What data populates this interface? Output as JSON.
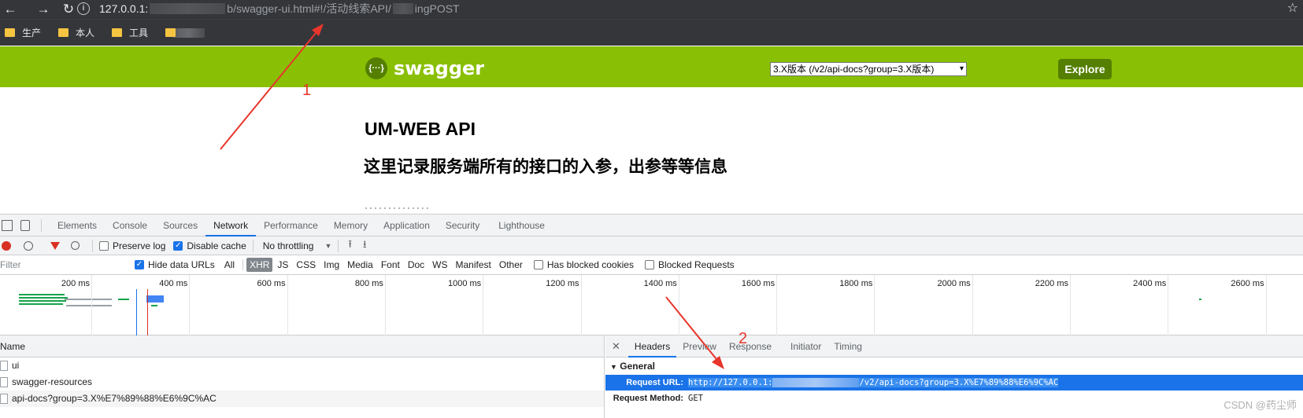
{
  "browser": {
    "url_host": "127.0.0.1:",
    "url_path": "b/swagger-ui.html#!/活动线索API/",
    "url_tail": "ingPOST",
    "bookmarks": [
      {
        "label": "生产"
      },
      {
        "label": "本人"
      },
      {
        "label": "工具"
      }
    ]
  },
  "swagger": {
    "logo_glyph": "{···}",
    "logo_text": "swagger",
    "group_select_value": "3.X版本 (/v2/api-docs?group=3.X版本)",
    "explore_label": "Explore",
    "api_title": "UM-WEB API",
    "api_description": "这里记录服务端所有的接口的入参，出参等等信息"
  },
  "devtools": {
    "tabs": [
      "Elements",
      "Console",
      "Sources",
      "Network",
      "Performance",
      "Memory",
      "Application",
      "Security",
      "Lighthouse"
    ],
    "active_tab": "Network",
    "toolbar": {
      "preserve_log": "Preserve log",
      "disable_cache": "Disable cache",
      "throttling": "No throttling"
    },
    "filter": {
      "placeholder": "Filter",
      "hide_data_urls": "Hide data URLs",
      "types": [
        "All",
        "XHR",
        "JS",
        "CSS",
        "Img",
        "Media",
        "Font",
        "Doc",
        "WS",
        "Manifest",
        "Other"
      ],
      "active_type": "XHR",
      "has_blocked_cookies": "Has blocked cookies",
      "blocked_requests": "Blocked Requests"
    },
    "timeline_ticks": [
      "200 ms",
      "400 ms",
      "600 ms",
      "800 ms",
      "1000 ms",
      "1200 ms",
      "1400 ms",
      "1600 ms",
      "1800 ms",
      "2000 ms",
      "2200 ms",
      "2400 ms",
      "2600 ms"
    ],
    "name_header": "Name",
    "requests": [
      "ui",
      "swagger-resources",
      "api-docs?group=3.X%E7%89%88%E6%9C%AC"
    ],
    "detail_tabs": [
      "Headers",
      "Preview",
      "Response",
      "Initiator",
      "Timing"
    ],
    "active_detail_tab": "Headers",
    "general_label": "General",
    "request_url_key": "Request URL:",
    "request_url_prefix": "http://127.0.0.1:",
    "request_url_suffix": "/v2/api-docs?group=3.X%E7%89%88%E6%9C%AC",
    "request_method_key": "Request Method:",
    "request_method_value": "GET"
  },
  "annotations": {
    "label_1": "1",
    "label_2": "2"
  },
  "watermark": "CSDN @药尘师",
  "colors": {
    "swagger_green": "#89bf04",
    "swagger_dark": "#547f00",
    "annotation_red": "#e8362c",
    "selection_blue": "#1a73e8"
  }
}
